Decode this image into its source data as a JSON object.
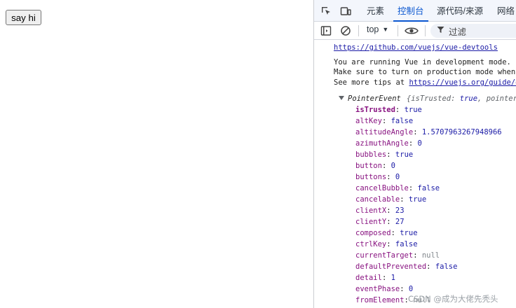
{
  "page": {
    "button_label": "say hi"
  },
  "devtools": {
    "tabs": [
      {
        "label": "元素"
      },
      {
        "label": "控制台"
      },
      {
        "label": "源代码/来源"
      },
      {
        "label": "网络"
      }
    ],
    "active_tab": "控制台",
    "toolbar": {
      "context": "top",
      "filter_placeholder": "过滤"
    },
    "console": {
      "devtools_link": "https://github.com/vuejs/vue-devtools",
      "dev_mode_line": "You are running Vue in development mode.",
      "prod_line": "Make sure to turn on production mode when de",
      "tips_prefix": "See more tips at ",
      "tips_link": "https://vuejs.org/guide/dep",
      "object": {
        "class_name": "PointerEvent",
        "preview_open": "{",
        "preview_k1": "isTrusted",
        "preview_v1": "true",
        "preview_k2": "pointerI",
        "properties": [
          {
            "key": "isTrusted",
            "value": "true",
            "type": "bool"
          },
          {
            "key": "altKey",
            "value": "false",
            "type": "bool"
          },
          {
            "key": "altitudeAngle",
            "value": "1.5707963267948966",
            "type": "num"
          },
          {
            "key": "azimuthAngle",
            "value": "0",
            "type": "num"
          },
          {
            "key": "bubbles",
            "value": "true",
            "type": "bool"
          },
          {
            "key": "button",
            "value": "0",
            "type": "num"
          },
          {
            "key": "buttons",
            "value": "0",
            "type": "num"
          },
          {
            "key": "cancelBubble",
            "value": "false",
            "type": "bool"
          },
          {
            "key": "cancelable",
            "value": "true",
            "type": "bool"
          },
          {
            "key": "clientX",
            "value": "23",
            "type": "num"
          },
          {
            "key": "clientY",
            "value": "27",
            "type": "num"
          },
          {
            "key": "composed",
            "value": "true",
            "type": "bool"
          },
          {
            "key": "ctrlKey",
            "value": "false",
            "type": "bool"
          },
          {
            "key": "currentTarget",
            "value": "null",
            "type": "null"
          },
          {
            "key": "defaultPrevented",
            "value": "false",
            "type": "bool"
          },
          {
            "key": "detail",
            "value": "1",
            "type": "num"
          },
          {
            "key": "eventPhase",
            "value": "0",
            "type": "num"
          },
          {
            "key": "fromElement",
            "value": "null",
            "type": "null"
          }
        ]
      }
    }
  },
  "watermark": "CSDN @成为大佬先秃头",
  "colors": {
    "accent": "#0b57d0",
    "key": "#881280",
    "value": "#1a1aa6",
    "link": "#1a1aa6"
  }
}
